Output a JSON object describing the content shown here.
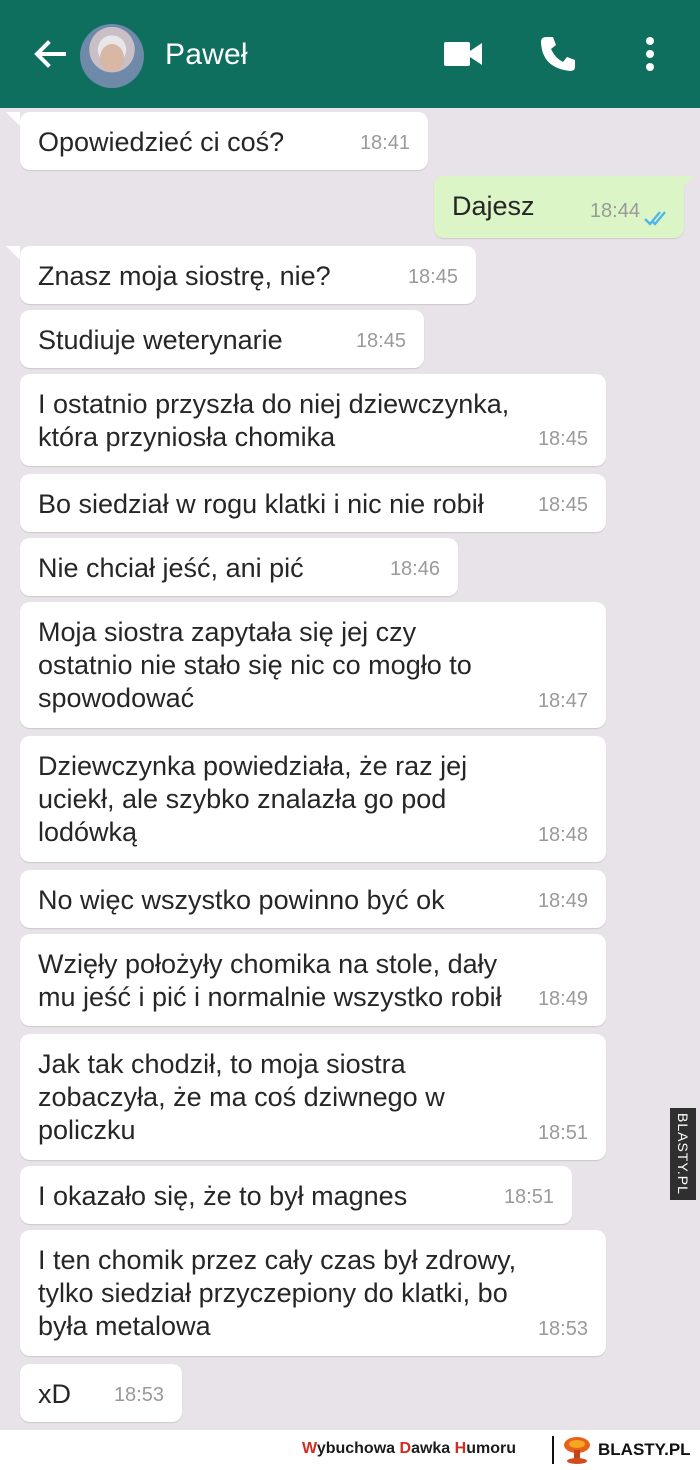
{
  "header": {
    "contact_name": "Paweł",
    "back_icon": "arrow-left-icon",
    "video_icon": "video-camera-icon",
    "call_icon": "phone-icon",
    "menu_icon": "more-vertical-icon"
  },
  "messages": [
    {
      "text": "Opowiedzieć ci coś?",
      "time": "18:41",
      "dir": "in"
    },
    {
      "text": "Dajesz",
      "time": "18:44",
      "dir": "out"
    },
    {
      "text": "Znasz moja siostrę, nie?",
      "time": "18:45",
      "dir": "in"
    },
    {
      "text": "Studiuje weterynarie",
      "time": "18:45",
      "dir": "in"
    },
    {
      "text": "I ostatnio przyszła do niej dziewczynka,\nktóra przyniosła chomika",
      "time": "18:45",
      "dir": "in"
    },
    {
      "text": "Bo siedział w rogu klatki i nic nie robił",
      "time": "18:45",
      "dir": "in"
    },
    {
      "text": "Nie chciał jeść, ani pić",
      "time": "18:46",
      "dir": "in"
    },
    {
      "text": "Moja siostra zapytała się jej czy\nostatnio nie stało się nic co mogło to\nspowodować",
      "time": "18:47",
      "dir": "in"
    },
    {
      "text": "Dziewczynka powiedziała, że raz jej\nuciekł, ale szybko znalazła go pod\nlodówką",
      "time": "18:48",
      "dir": "in"
    },
    {
      "text": "No więc wszystko powinno być ok",
      "time": "18:49",
      "dir": "in"
    },
    {
      "text": "Wzięły położyły chomika na stole, dały\nmu jeść i pić i normalnie wszystko robił",
      "time": "18:49",
      "dir": "in"
    },
    {
      "text": "Jak tak chodził, to moja siostra\nzobaczyła, że ma coś dziwnego w\npoliczku",
      "time": "18:51",
      "dir": "in"
    },
    {
      "text": "I okazało się, że to był magnes",
      "time": "18:51",
      "dir": "in"
    },
    {
      "text": "I ten chomik przez cały czas był zdrowy,\ntylko siedział przyczepiony do klatki, bo\nbyła metalowa",
      "time": "18:53",
      "dir": "in"
    },
    {
      "text": "xD",
      "time": "18:53",
      "dir": "in"
    }
  ],
  "watermark": {
    "side_text": "BLASTY.PL",
    "footer_w1": "W",
    "footer_w1_rest": "ybuchowa ",
    "footer_w2": "D",
    "footer_w2_rest": "awka ",
    "footer_w3": "H",
    "footer_w3_rest": "umoru",
    "logo_text": "BLASTY.PL"
  },
  "colors": {
    "header": "#0e6f5e",
    "background": "#e8e3e8",
    "incoming": "#ffffff",
    "outgoing": "#dcf5c6",
    "read_ticks": "#4fb6ec"
  }
}
